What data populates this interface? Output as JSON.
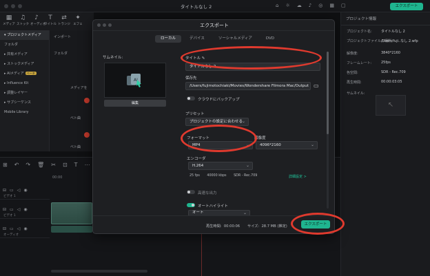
{
  "app": {
    "title": "タイトルなし 2",
    "top_export_label": "エクスポート"
  },
  "toolbar": [
    {
      "icon": "▦",
      "label": "メディア"
    },
    {
      "icon": "♫",
      "label": "ストック"
    },
    {
      "icon": "♪",
      "label": "オーディオ"
    },
    {
      "icon": "T",
      "label": "タイトル"
    },
    {
      "icon": "⇄",
      "label": "トランジ"
    },
    {
      "icon": "✦",
      "label": "エフェ"
    }
  ],
  "left_panel": {
    "items": [
      {
        "label": "▾ プロジェクトメディア",
        "active": true
      },
      {
        "label": "  フォルダ",
        "active": false
      },
      {
        "label": "▸ 共有メディア",
        "active": false
      },
      {
        "label": "▸ ストックメディア",
        "active": false
      },
      {
        "label": "▸ AIメディア",
        "active": false,
        "badge": "ベータ"
      },
      {
        "label": "▸ Influence Kit",
        "active": false
      },
      {
        "label": "▸ 調整レイヤー",
        "active": false
      },
      {
        "label": "▸ サブシーケンス",
        "active": false
      },
      {
        "label": "  Mobile Library",
        "active": false
      }
    ]
  },
  "media_area": {
    "import_label": "インポート",
    "folder_label": "フォルダ",
    "media_label": "メディアを",
    "hint1": "ベト曲",
    "hint2": "ベト曲"
  },
  "right_panel": {
    "header": "プロジェクト情報",
    "rows": [
      {
        "key": "プロジェクト名:",
        "value": "タイトルなし 2"
      },
      {
        "key": "プロジェクトファイルの場所:",
        "value": "/Users/fuji..なし 2.wfp"
      },
      {
        "key": "解像度:",
        "value": "3840*2160"
      },
      {
        "key": "フレームレート:",
        "value": "25fps"
      },
      {
        "key": "色空間:",
        "value": "SDR - Rec.709"
      },
      {
        "key": "再生時間:",
        "value": "00:00:03:05"
      },
      {
        "key": "サムネイル:",
        "value": ""
      }
    ]
  },
  "timeline": {
    "ruler_time": "00:00",
    "tracks": [
      {
        "name": "ビデオ 1"
      },
      {
        "name": "ビデオ 1"
      },
      {
        "name": "オーディオ"
      }
    ]
  },
  "dialog": {
    "title": "エクスポート",
    "tabs": [
      {
        "label": "ローカル",
        "active": true
      },
      {
        "label": "デバイス",
        "active": false
      },
      {
        "label": "ソーシャルメディア",
        "active": false
      },
      {
        "label": "DVD",
        "active": false
      }
    ],
    "thumbnail_label": "サムネイル:",
    "edit_label": "編集",
    "name_label": "タイトル",
    "name_value": "タイトルなし 2",
    "save_to_label": "保存先",
    "save_to_value": "/Users/fujimotochiaki/Movies/Wondershare Filmora Mac/Output",
    "cloud_backup_label": "クラウドにバックアップ",
    "preset_label": "プリセット",
    "preset_value": "プロジェクトの設定に合わせる",
    "format_label": "フォーマット",
    "format_value": "MP4",
    "resolution_label": "解像度",
    "resolution_value": "4096*2160",
    "encoder_label": "エンコーダ",
    "encoder_value": "H.264",
    "info_fps": "25 fps",
    "info_bitrate": "40000 kbps",
    "info_color": "SDR - Rec.709",
    "detail_settings": "詳細設定 >",
    "gpu_label": "高速な出力",
    "auto_highlight_label": "オートハイライト",
    "auto_value": "オート",
    "duration_label": "再生時間:",
    "duration_value": "00:00:06",
    "size_label": "サイズ:",
    "size_value": "28.7 MB (推定)",
    "export_label": "エクスポート"
  },
  "colors": {
    "accent": "#1fb58f",
    "annotation": "#e03a2e"
  }
}
